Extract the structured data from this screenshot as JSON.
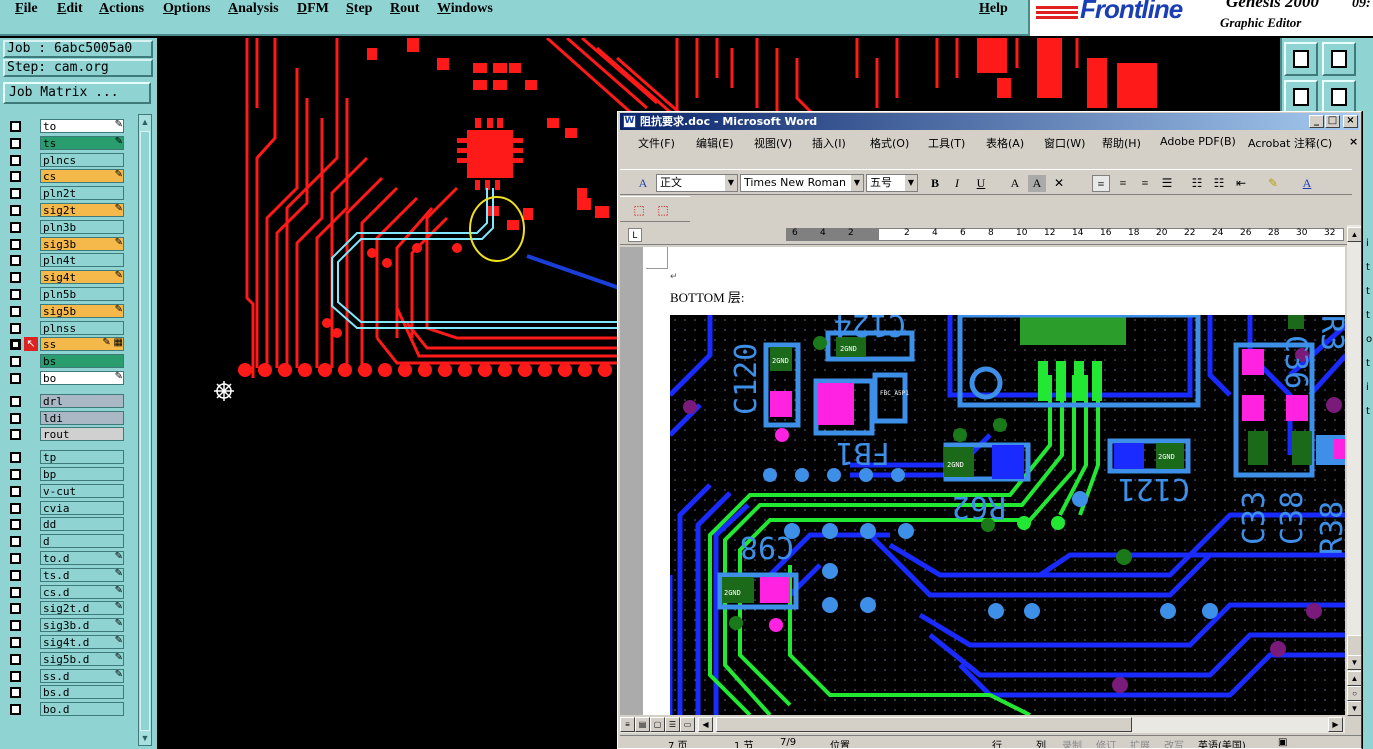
{
  "genesis": {
    "menu": [
      "File",
      "Edit",
      "Actions",
      "Options",
      "Analysis",
      "DFM",
      "Step",
      "Rout",
      "Windows"
    ],
    "help": "Help",
    "brand": "Frontline",
    "product": "Genesis 2000",
    "product_sub": "Graphic Editor",
    "clock": "09:",
    "job_label": "Job : 6abc5005a0",
    "step_label": "Step: cam.org",
    "job_matrix": "Job Matrix ...",
    "layers": [
      {
        "name": "to",
        "color": "#ffffff",
        "mark": "✎",
        "active": true
      },
      {
        "name": "ts",
        "color": "#2a9d6e",
        "mark": "✎",
        "active": true
      },
      {
        "name": "plncs",
        "color": "#8fd3d3",
        "mark": "",
        "active": false
      },
      {
        "name": "cs",
        "color": "#f5b84a",
        "mark": "✎",
        "active": true
      },
      {
        "name": "pln2t",
        "color": "#8fd3d3",
        "mark": "",
        "active": false
      },
      {
        "name": "sig2t",
        "color": "#f5b84a",
        "mark": "✎",
        "active": true
      },
      {
        "name": "pln3b",
        "color": "#8fd3d3",
        "mark": "",
        "active": false
      },
      {
        "name": "sig3b",
        "color": "#f5b84a",
        "mark": "✎",
        "active": true
      },
      {
        "name": "pln4t",
        "color": "#8fd3d3",
        "mark": "",
        "active": false
      },
      {
        "name": "sig4t",
        "color": "#f5b84a",
        "mark": "✎",
        "active": true
      },
      {
        "name": "pln5b",
        "color": "#8fd3d3",
        "mark": "",
        "active": false
      },
      {
        "name": "sig5b",
        "color": "#f5b84a",
        "mark": "✎",
        "active": true
      },
      {
        "name": "plnss",
        "color": "#8fd3d3",
        "mark": "",
        "active": false
      },
      {
        "name": "ss",
        "color": "#f5b84a",
        "mark": "✎ ▦",
        "active": true,
        "work": true
      },
      {
        "name": "bs",
        "color": "#2a9d6e",
        "mark": "",
        "active": true
      },
      {
        "name": "bo",
        "color": "#ffffff",
        "mark": "✎",
        "active": true
      },
      {
        "name": "drl",
        "color": "#a9b8c4",
        "mark": "",
        "active": false
      },
      {
        "name": "ldi",
        "color": "#a9b8c4",
        "mark": "",
        "active": false
      },
      {
        "name": "rout",
        "color": "#d0d0d0",
        "mark": "",
        "active": false
      },
      {
        "name": "tp",
        "color": "#8fd3d3",
        "mark": "",
        "active": false
      },
      {
        "name": "bp",
        "color": "#8fd3d3",
        "mark": "",
        "active": false
      },
      {
        "name": "v-cut",
        "color": "#8fd3d3",
        "mark": "",
        "active": false
      },
      {
        "name": "cvia",
        "color": "#8fd3d3",
        "mark": "",
        "active": false
      },
      {
        "name": "dd",
        "color": "#8fd3d3",
        "mark": "",
        "active": false
      },
      {
        "name": "d",
        "color": "#8fd3d3",
        "mark": "",
        "active": false
      },
      {
        "name": "to.d",
        "color": "#8fd3d3",
        "mark": "✎",
        "active": false
      },
      {
        "name": "ts.d",
        "color": "#8fd3d3",
        "mark": "✎",
        "active": false
      },
      {
        "name": "cs.d",
        "color": "#8fd3d3",
        "mark": "✎",
        "active": false
      },
      {
        "name": "sig2t.d",
        "color": "#8fd3d3",
        "mark": "✎",
        "active": false
      },
      {
        "name": "sig3b.d",
        "color": "#8fd3d3",
        "mark": "✎",
        "active": false
      },
      {
        "name": "sig4t.d",
        "color": "#8fd3d3",
        "mark": "✎",
        "active": false
      },
      {
        "name": "sig5b.d",
        "color": "#8fd3d3",
        "mark": "✎",
        "active": false
      },
      {
        "name": "ss.d",
        "color": "#8fd3d3",
        "mark": "✎",
        "active": false
      },
      {
        "name": "bs.d",
        "color": "#8fd3d3",
        "mark": "",
        "active": false
      },
      {
        "name": "bo.d",
        "color": "#8fd3d3",
        "mark": "",
        "active": false
      }
    ],
    "right_labels": [
      "i",
      "t",
      "t",
      "t",
      "o",
      "t",
      "i",
      "t"
    ]
  },
  "word": {
    "title": "阻抗要求.doc - Microsoft Word",
    "menu": [
      "文件(F)",
      "编辑(E)",
      "视图(V)",
      "插入(I)",
      "格式(O)",
      "工具(T)",
      "表格(A)",
      "窗口(W)",
      "帮助(H)",
      "Adobe PDF(B)",
      "Acrobat 注释(C)"
    ],
    "style": "正文",
    "font": "Times New Roman",
    "size": "五号",
    "ruler_numbers": [
      "6",
      "4",
      "2",
      "2",
      "4",
      "6",
      "8",
      "10",
      "12",
      "14",
      "16",
      "18",
      "20",
      "22",
      "24",
      "26",
      "28",
      "30",
      "32"
    ],
    "heading_text": "BOTTOM 层:",
    "paragraph_mark": "↵",
    "status": {
      "page": "7 页",
      "section": "1 节",
      "pages": "7/9",
      "position": "位置",
      "line": "行",
      "col": "列",
      "rec": "录制",
      "trk": "修订",
      "ext": "扩展",
      "ovr": "改写",
      "lang": "英语(美国)"
    },
    "silk_labels": [
      "C120",
      "C124",
      "FB1",
      "R62",
      "C121",
      "C98",
      "C33",
      "C38",
      "R38",
      "C36",
      "R3"
    ],
    "pad_label": "2GND",
    "pad_label2": "FBC_A5P1"
  },
  "colors": {
    "pcb_red": "#ff1a1a",
    "trace_cyan": "#7fe8ff",
    "bottom_blue": "#1a2bff",
    "pad_lightblue": "#3d8fe8",
    "trace_green": "#22e833",
    "magenta": "#ff22e0",
    "annotation_yellow": "#f0e020",
    "arrow_blue": "#1a3fd8"
  }
}
